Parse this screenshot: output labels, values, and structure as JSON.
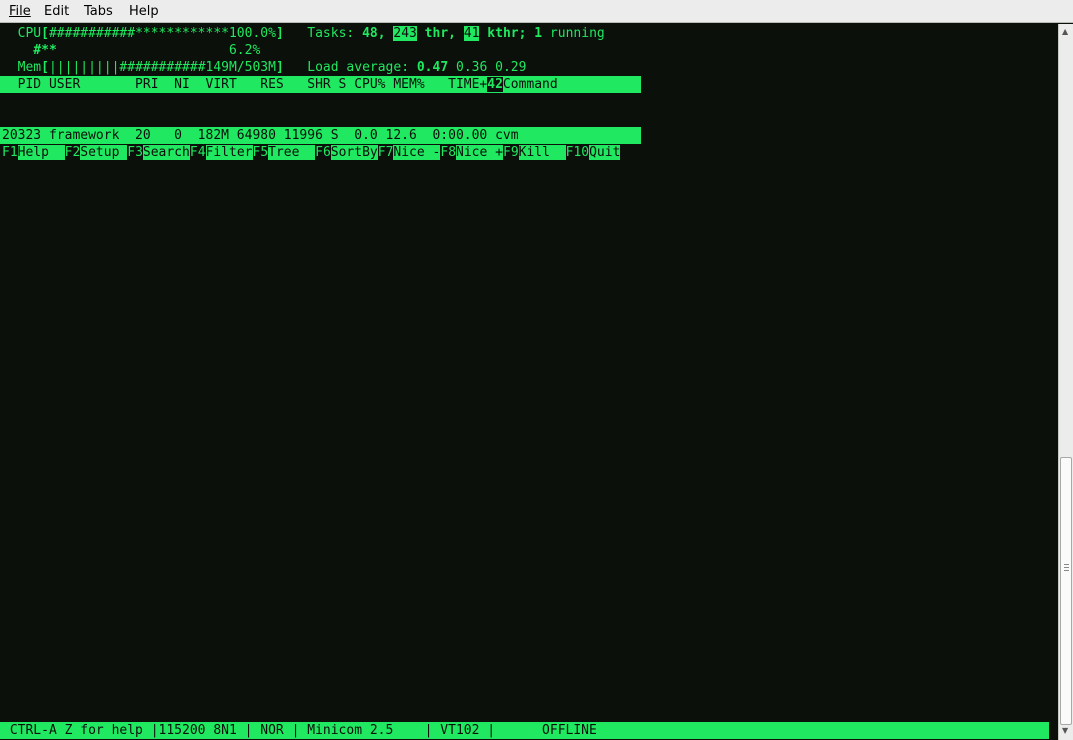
{
  "menubar": {
    "items": [
      {
        "label": "File"
      },
      {
        "label": "Edit"
      },
      {
        "label": "Tabs"
      },
      {
        "label": "Help"
      }
    ]
  },
  "htop": {
    "cpu_label": "  CPU",
    "cpu_open": "[",
    "cpu_hashes": "###########",
    "cpu_stars": "************",
    "cpu_value": "100.0%",
    "cpu_close": "]",
    "cpu_usage_percent": 100.0,
    "cpu2_bar": "    #**",
    "cpu2_pad": "                      ",
    "cpu2_value": "6.2%",
    "mem_label": "  Mem",
    "mem_open": "[",
    "mem_pipes": "|||||||||",
    "mem_hashes": "###########",
    "mem_value": "149M/503M",
    "mem_close": "]",
    "tasks_label": "   Tasks: ",
    "tasks_count": "48",
    "tasks_sep": ", ",
    "threads": "243",
    "threads_label": " thr, ",
    "kthreads": "41",
    "kthreads_label": " kthr; ",
    "running_count": "1",
    "running_label": " running",
    "load_label": "   Load average: ",
    "load1": "0.47",
    "load5": " 0.36",
    "load15": " 0.29",
    "header_left": "  PID USER       PRI  NI  VIRT   RES   SHR S CPU% MEM%   TIME+",
    "header_right": "42",
    "header_command": "Command",
    "process": {
      "row": "20323 framework  20   0  182M 64980 11996 S  0.0 12.6  0:00.00 cvm"
    },
    "fkeys": [
      {
        "key": "F1",
        "label": "Help  "
      },
      {
        "key": "F2",
        "label": "Setup "
      },
      {
        "key": "F3",
        "label": "Search"
      },
      {
        "key": "F4",
        "label": "Filter"
      },
      {
        "key": "F5",
        "label": "Tree  "
      },
      {
        "key": "F6",
        "label": "SortBy"
      },
      {
        "key": "F7",
        "label": "Nice -"
      },
      {
        "key": "F8",
        "label": "Nice +"
      },
      {
        "key": "F9",
        "label": "Kill  "
      },
      {
        "key": "F10",
        "label": "Quit"
      }
    ]
  },
  "minicom_status": {
    "text": " CTRL-A Z for help |115200 8N1 | NOR | Minicom 2.5    | VT102 |      OFFLINE"
  },
  "colors": {
    "terminal_bg": "#0b100a",
    "terminal_fg": "#20e860",
    "menubar_bg": "#ececec"
  },
  "icons": [
    "scroll-up-arrow-icon",
    "scroll-down-arrow-icon",
    "scroll-grip-icon"
  ]
}
